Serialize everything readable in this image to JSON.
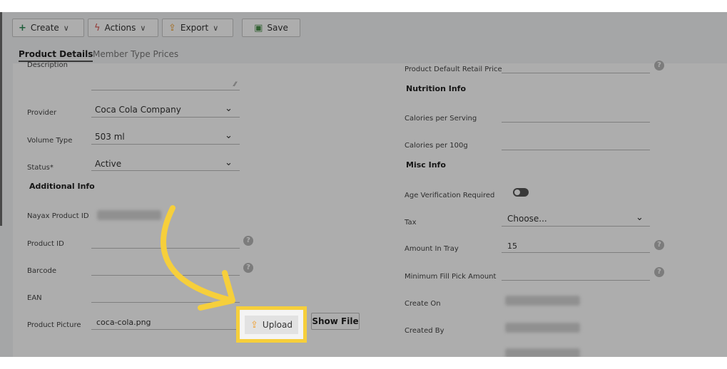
{
  "toolbar": {
    "create_label": "Create",
    "actions_label": "Actions",
    "export_label": "Export",
    "save_label": "Save"
  },
  "tabs": [
    {
      "label": "Product Details",
      "active": true
    },
    {
      "label": "Member Type Prices",
      "active": false
    }
  ],
  "left": {
    "description_label": "Description",
    "provider_label": "Provider",
    "provider_value": "Coca Cola Company",
    "volume_label": "Volume Type",
    "volume_value": "503 ml",
    "status_label": "Status*",
    "status_value": "Active",
    "additional_info": "Additional Info",
    "nayax_label": "Nayax Product ID",
    "product_id_label": "Product ID",
    "barcode_label": "Barcode",
    "ean_label": "EAN",
    "picture_label": "Product Picture",
    "picture_value": "coca-cola.png",
    "upload_label": "Upload",
    "show_file_label": "Show File"
  },
  "right": {
    "retail_price_label": "Product Default Retail Price",
    "nutrition_info": "Nutrition Info",
    "calories_serving_label": "Calories per Serving",
    "calories_100g_label": "Calories per 100g",
    "misc_info": "Misc Info",
    "age_verification_label": "Age Verification Required",
    "tax_label": "Tax",
    "tax_value": "Choose...",
    "amount_tray_label": "Amount In Tray",
    "amount_tray_value": "15",
    "min_fill_label": "Minimum Fill Pick Amount",
    "create_on_label": "Create On",
    "created_by_label": "Created By"
  },
  "colors": {
    "highlight": "#f6cf3b",
    "overlay": "rgba(0,0,0,0.32)",
    "create_icon": "#2e8b57",
    "actions_icon": "#d9534f",
    "export_icon": "#f0a030"
  },
  "icons": {
    "create": "plus-icon",
    "actions": "lightning-icon",
    "export": "upload-icon",
    "save": "save-icon",
    "upload": "upload-icon",
    "help": "question-icon"
  }
}
